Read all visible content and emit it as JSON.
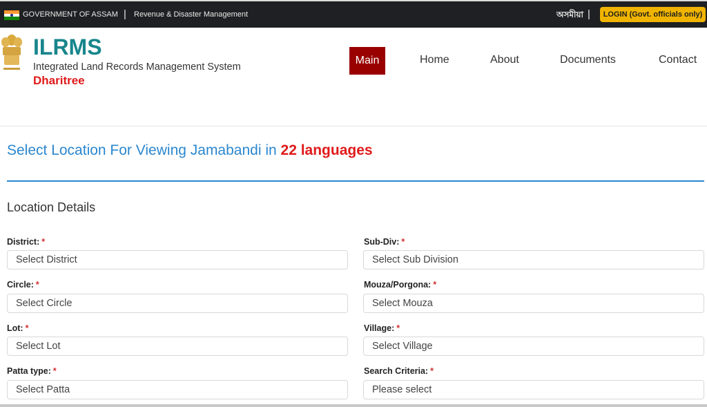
{
  "topbar": {
    "government_label": "GOVERNMENT OF ASSAM",
    "separator": "|",
    "department_label": "Revenue & Disaster Management",
    "language_link": "অসমীয়া",
    "login_button": "LOGIN (Govt. officials only)"
  },
  "header": {
    "brand_title": "ILRMS",
    "brand_subtitle": "Integrated Land Records Management System",
    "brand_tagline": "Dharitree",
    "nav": [
      {
        "label": "Main",
        "active": true
      },
      {
        "label": "Home"
      },
      {
        "label": "About"
      },
      {
        "label": "Documents"
      },
      {
        "label": "Contact"
      }
    ]
  },
  "main": {
    "heading_prefix": "Select Location For Viewing Jamabandi in ",
    "heading_highlight": "22 languages",
    "section_title": "Location Details",
    "required_marker": "*",
    "fields": [
      {
        "label": "District:",
        "value": "Select District"
      },
      {
        "label": "Sub-Div:",
        "value": "Select Sub Division"
      },
      {
        "label": "Circle:",
        "value": "Select Circle"
      },
      {
        "label": "Mouza/Porgona:",
        "value": "Select Mouza"
      },
      {
        "label": "Lot:",
        "value": "Select Lot"
      },
      {
        "label": "Village:",
        "value": "Select Village"
      },
      {
        "label": "Patta type:",
        "value": "Select Patta"
      },
      {
        "label": "Search Criteria:",
        "value": "Please select"
      }
    ]
  },
  "colors": {
    "accent_blue": "#2b87cf",
    "brand_teal": "#18868c",
    "highlight_red": "#e01a1a",
    "nav_active": "#990000",
    "login_yellow": "#f0b400"
  }
}
